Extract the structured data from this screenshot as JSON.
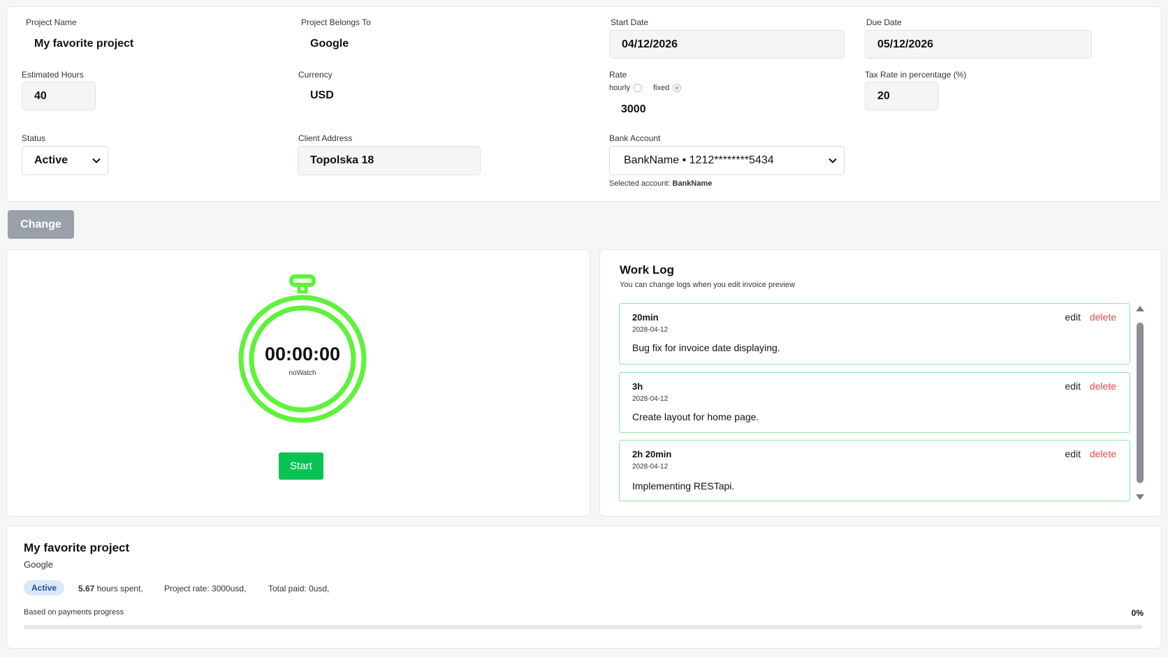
{
  "form": {
    "project_name": {
      "label": "Project Name",
      "value": "My favorite project"
    },
    "project_belongs_to": {
      "label": "Project Belongs To",
      "value": "Google"
    },
    "start_date": {
      "label": "Start Date",
      "value": "04/12/2026"
    },
    "due_date": {
      "label": "Due Date",
      "value": "05/12/2026"
    },
    "estimated_hours": {
      "label": "Estimated Hours",
      "value": "40"
    },
    "currency": {
      "label": "Currency",
      "value": "USD"
    },
    "rate": {
      "label": "Rate",
      "hourly_label": "hourly",
      "fixed_label": "fixed",
      "selected": "fixed",
      "value": "3000"
    },
    "tax_rate": {
      "label": "Tax Rate in percentage (%)",
      "value": "20"
    },
    "status": {
      "label": "Status",
      "value": "Active"
    },
    "client_address": {
      "label": "Client Address",
      "value": "Topolska 18"
    },
    "bank_account": {
      "label": "Bank Account",
      "value": "BankName • 1212********5434",
      "selected_prefix": "Selected account:",
      "selected_name": "BankName"
    }
  },
  "change_button": "Change",
  "stopwatch": {
    "time": "00:00:00",
    "subtitle": "noWatch",
    "start_label": "Start",
    "color": "#5ef23a"
  },
  "work_log": {
    "title": "Work Log",
    "subtitle": "You can change logs when you edit invoice preview",
    "edit_label": "edit",
    "delete_label": "delete",
    "entries": [
      {
        "duration": "20min",
        "date": "2028-04-12",
        "description": "Bug fix for invoice date displaying."
      },
      {
        "duration": "3h",
        "date": "2028-04-12",
        "description": "Create layout for home page."
      },
      {
        "duration": "2h 20min",
        "date": "2028-04-12",
        "description": "Implementing RESTapi."
      }
    ]
  },
  "summary": {
    "title": "My favorite project",
    "client": "Google",
    "status_badge": "Active",
    "hours_value": "5.67",
    "hours_suffix": "hours spent,",
    "project_rate": "Project rate: 3000usd,",
    "total_paid": "Total paid: 0usd,",
    "progress_label": "Based on payments progress",
    "progress_value": "0%",
    "progress_fraction": 0
  },
  "colors": {
    "accent_green": "#07c452",
    "delete_red": "#e5484d",
    "log_border": "#8de5a6"
  }
}
